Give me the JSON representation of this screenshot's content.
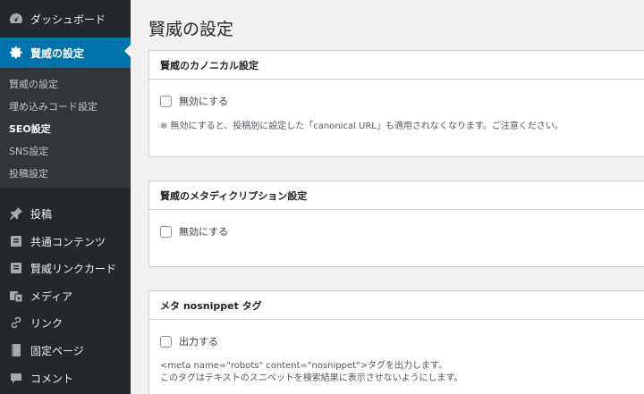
{
  "sidebar": {
    "items": [
      {
        "label": "ダッシュボード",
        "icon": "dashboard-icon"
      },
      {
        "label": "賢威の設定",
        "icon": "gear-icon"
      },
      {
        "label": "投稿",
        "icon": "pin-icon"
      },
      {
        "label": "共通コンテンツ",
        "icon": "doc-icon"
      },
      {
        "label": "賢威リンクカード",
        "icon": "doc-icon"
      },
      {
        "label": "メディア",
        "icon": "media-icon"
      },
      {
        "label": "リンク",
        "icon": "link-icon"
      },
      {
        "label": "固定ページ",
        "icon": "page-icon"
      },
      {
        "label": "コメント",
        "icon": "comment-icon"
      }
    ],
    "submenu": [
      "賢威の設定",
      "埋め込みコード設定",
      "SEO設定",
      "SNS設定",
      "投稿設定"
    ],
    "active_submenu": "SEO設定"
  },
  "main": {
    "title": "賢威の設定",
    "sections": [
      {
        "title": "賢威のカノニカル設定",
        "checkbox_label": "無効にする",
        "note": "※ 無効にすると、投稿別に設定した「canonical URL」も適用されなくなります。ご注意ください。"
      },
      {
        "title": "賢威のメタディクリプション設定",
        "checkbox_label": "無効にする"
      },
      {
        "title": "メタ nosnippet タグ",
        "checkbox_label": "出力する",
        "note_lines": [
          "<meta name=\"robots\" content=\"nosnippet\">タグを出力します。",
          "このタグはテキストのスニペットを検索結果に表示させないようにします。"
        ]
      }
    ]
  },
  "colors": {
    "sidebar_bg": "#23282d",
    "submenu_bg": "#32373c",
    "accent": "#0073aa",
    "page_bg": "#f1f1f1"
  }
}
